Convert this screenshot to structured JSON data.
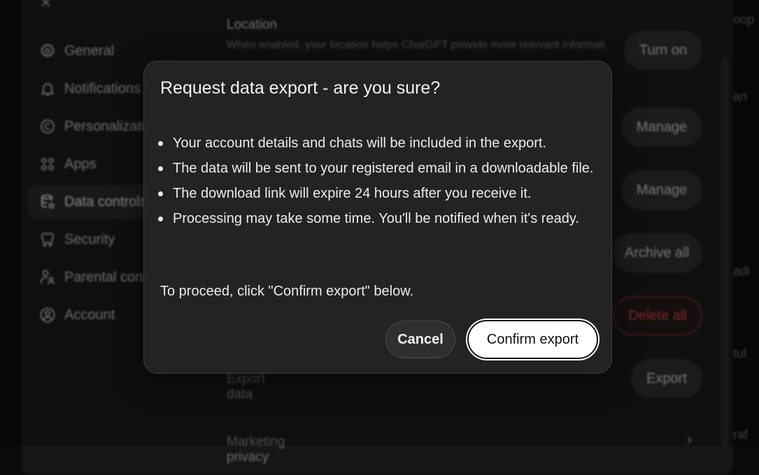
{
  "background": {
    "close_symbol": "×",
    "sidebar": {
      "items": [
        {
          "label": "General",
          "icon": "gear-icon"
        },
        {
          "label": "Notifications",
          "icon": "bell-icon"
        },
        {
          "label": "Personalization",
          "icon": "personalization-icon"
        },
        {
          "label": "Apps",
          "icon": "apps-grid-icon"
        },
        {
          "label": "Data controls",
          "icon": "database-icon",
          "active": true
        },
        {
          "label": "Security",
          "icon": "shield-icon"
        },
        {
          "label": "Parental controls",
          "icon": "parental-icon"
        },
        {
          "label": "Account",
          "icon": "user-circle-icon"
        }
      ]
    },
    "content": {
      "location_title": "Location",
      "location_desc": "When enabled, your location helps ChatGPT provide more relevant information, like local recommendations, news, and weather, based on",
      "turn_on_label": "Turn on",
      "manage_label_1": "Manage",
      "manage_label_2": "Manage",
      "archive_all_label": "Archive all",
      "delete_all_label": "Delete all",
      "export_data_label": "Export data",
      "export_label": "Export",
      "marketing_privacy_label": "Marketing privacy"
    },
    "right_peek": [
      "oop",
      "an",
      "adi",
      "tul",
      "raf"
    ]
  },
  "modal": {
    "title": "Request data export - are you sure?",
    "bullets": [
      "Your account details and chats will be included in the export.",
      "The data will be sent to your registered email in a downloadable file.",
      "The download link will expire 24 hours after you receive it.",
      "Processing may take some time. You'll be notified when it's ready."
    ],
    "proceed_text": "To proceed, click \"Confirm export\" below.",
    "cancel_label": "Cancel",
    "confirm_label": "Confirm export"
  },
  "colors": {
    "modal_bg": "#232323",
    "danger": "#b03a3a",
    "confirm_bg": "#ffffff"
  }
}
